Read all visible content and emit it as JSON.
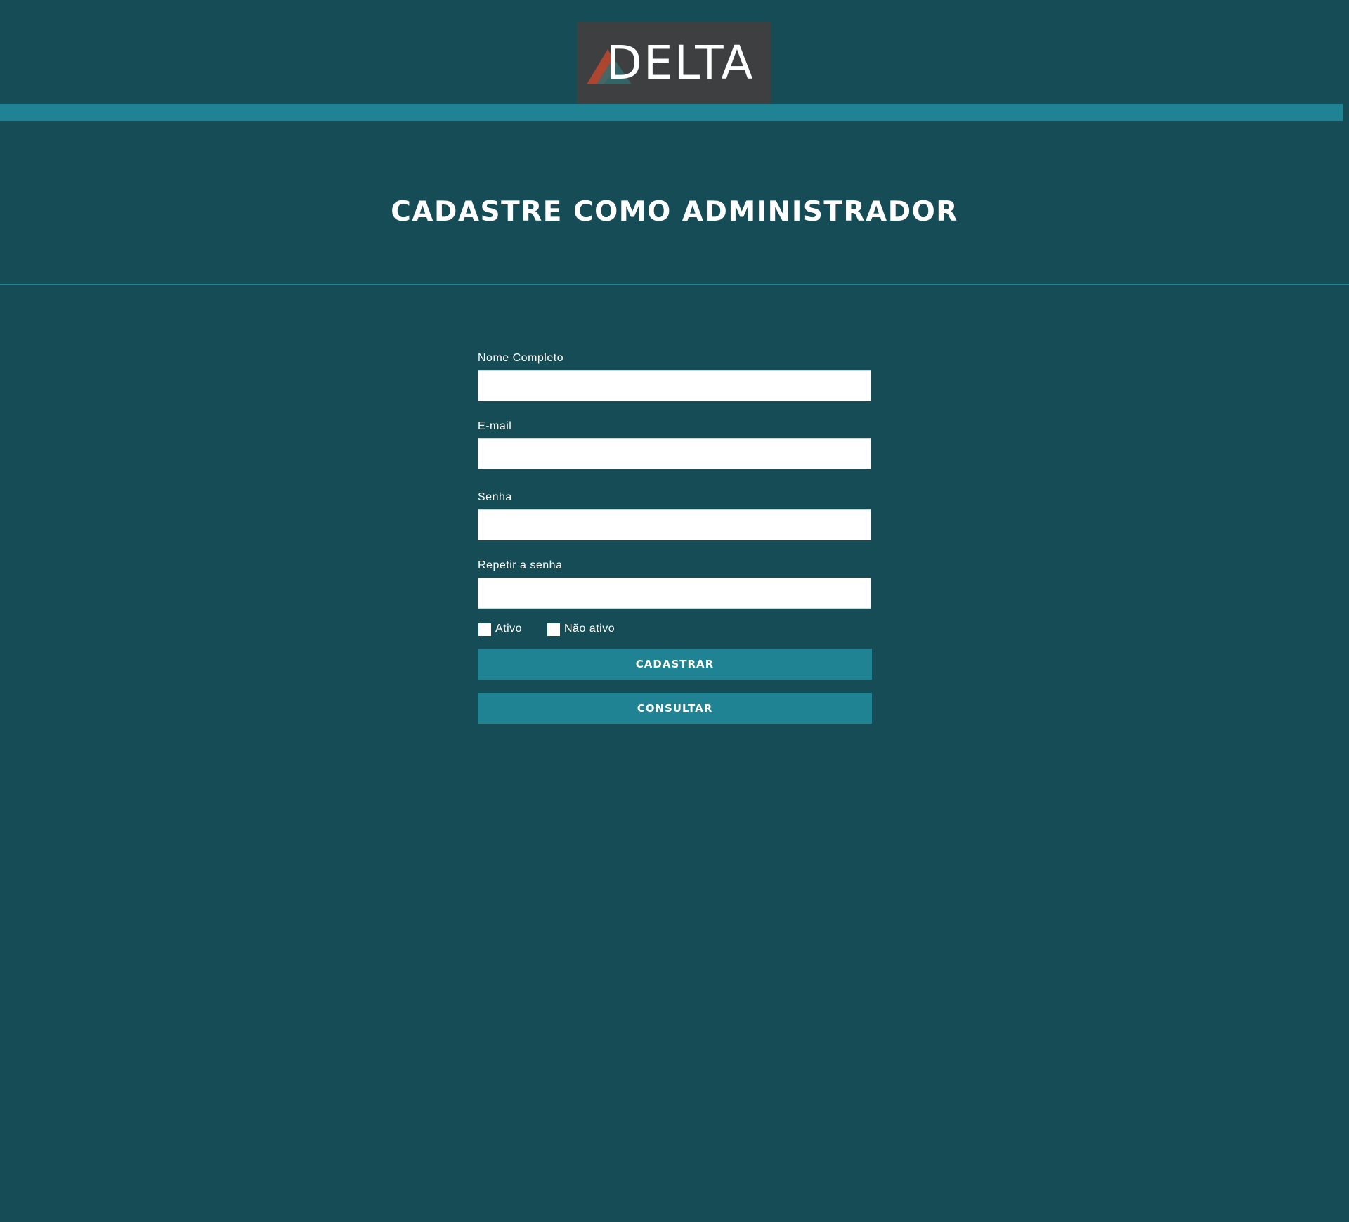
{
  "header": {
    "logo_text": "DELTA"
  },
  "page": {
    "title": "CADASTRE COMO ADMINISTRADOR"
  },
  "form": {
    "fields": [
      {
        "label": "Nome Completo",
        "value": "",
        "placeholder": ""
      },
      {
        "label": "E-mail",
        "value": "",
        "placeholder": ""
      },
      {
        "label": "Senha",
        "value": "",
        "placeholder": ""
      },
      {
        "label": "Repetir a senha",
        "value": "",
        "placeholder": ""
      }
    ],
    "status_options": [
      {
        "label": "Ativo",
        "checked": false
      },
      {
        "label": "Não ativo",
        "checked": false
      }
    ],
    "submit_label": "CADASTRAR",
    "consult_label": "CONSULTAR"
  },
  "colors": {
    "background": "#164c56",
    "accent": "#1f8393",
    "logo_background": "#3d3f41",
    "logo_triangle_red": "#c0482e",
    "logo_triangle_teal": "#2f6f72"
  },
  "icons": {
    "logo_mark": "triangle-icon"
  }
}
